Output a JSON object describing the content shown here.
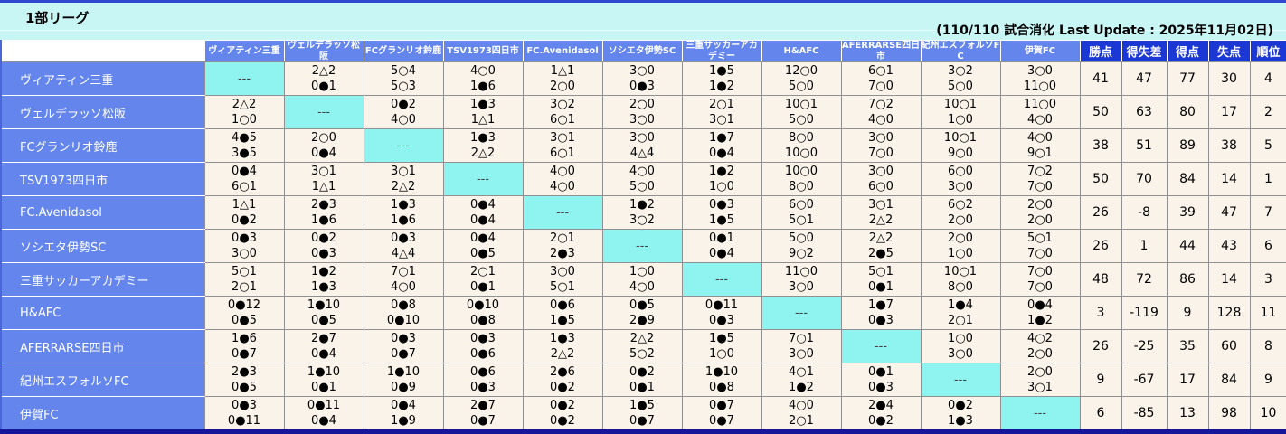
{
  "title": "1部リーグ",
  "update_note": "(110/110 試合消化 Last Update : 2025年11月02日)",
  "legend": {
    "win": "○",
    "loss": "●",
    "draw": "△",
    "self": "---"
  },
  "colors": {
    "band_cyan": "#c8f6f4",
    "header_blue": "#6486ec",
    "stat_header_blue": "#1c38d4",
    "diagonal_cyan": "#8ff4f0",
    "cell_bg": "#faf3ea",
    "bottom_bar_navy": "#16169b"
  },
  "stat_headers": [
    "勝点",
    "得失差",
    "得点",
    "失点",
    "順位"
  ],
  "teams": [
    "ヴィアティン三重",
    "ヴェルデラッソ松阪",
    "FCグランリオ鈴鹿",
    "TSV1973四日市",
    "FC.Avenidasol",
    "ソシエタ伊勢SC",
    "三重サッカーアカデミー",
    "H&AFC",
    "AFERRARSE四日市",
    "紀州エスフォルソFC",
    "伊賀FC"
  ],
  "rows": [
    {
      "team": "ヴィアティン三重",
      "matches": [
        null,
        [
          "2△2",
          "0●1"
        ],
        [
          "5○4",
          "5○3"
        ],
        [
          "4○0",
          "1●6"
        ],
        [
          "1△1",
          "2○0"
        ],
        [
          "3○0",
          "0●3"
        ],
        [
          "1●5",
          "1●2"
        ],
        [
          "12○0",
          "5○0"
        ],
        [
          "6○1",
          "7○0"
        ],
        [
          "3○2",
          "5○0"
        ],
        [
          "3○0",
          "11○0"
        ]
      ],
      "stats": [
        41,
        47,
        77,
        30,
        4
      ]
    },
    {
      "team": "ヴェルデラッソ松阪",
      "matches": [
        [
          "2△2",
          "1○0"
        ],
        null,
        [
          "0●2",
          "4○0"
        ],
        [
          "1●3",
          "1△1"
        ],
        [
          "3○2",
          "6○1"
        ],
        [
          "2○0",
          "3○0"
        ],
        [
          "2○1",
          "3○1"
        ],
        [
          "10○1",
          "5○0"
        ],
        [
          "7○2",
          "4○0"
        ],
        [
          "10○1",
          "1○0"
        ],
        [
          "11○0",
          "4○0"
        ]
      ],
      "stats": [
        50,
        63,
        80,
        17,
        2
      ]
    },
    {
      "team": "FCグランリオ鈴鹿",
      "matches": [
        [
          "4●5",
          "3●5"
        ],
        [
          "2○0",
          "0●4"
        ],
        null,
        [
          "1●3",
          "2△2"
        ],
        [
          "3○1",
          "6○1"
        ],
        [
          "3○0",
          "4△4"
        ],
        [
          "1●7",
          "0●4"
        ],
        [
          "8○0",
          "10○0"
        ],
        [
          "3○0",
          "7○0"
        ],
        [
          "10○1",
          "9○0"
        ],
        [
          "4○0",
          "9○1"
        ]
      ],
      "stats": [
        38,
        51,
        89,
        38,
        5
      ]
    },
    {
      "team": "TSV1973四日市",
      "matches": [
        [
          "0●4",
          "6○1"
        ],
        [
          "3○1",
          "1△1"
        ],
        [
          "3○1",
          "2△2"
        ],
        null,
        [
          "4○0",
          "4○0"
        ],
        [
          "4○0",
          "5○0"
        ],
        [
          "1●2",
          "1○0"
        ],
        [
          "10○0",
          "8○0"
        ],
        [
          "3○0",
          "6○0"
        ],
        [
          "6○0",
          "3○0"
        ],
        [
          "7○2",
          "7○0"
        ]
      ],
      "stats": [
        50,
        70,
        84,
        14,
        1
      ]
    },
    {
      "team": "FC.Avenidasol",
      "matches": [
        [
          "1△1",
          "0●2"
        ],
        [
          "2●3",
          "1●6"
        ],
        [
          "1●3",
          "1●6"
        ],
        [
          "0●4",
          "0●4"
        ],
        null,
        [
          "1●2",
          "3○2"
        ],
        [
          "0●3",
          "1●5"
        ],
        [
          "6○0",
          "5○1"
        ],
        [
          "3○1",
          "2△2"
        ],
        [
          "6○2",
          "2○0"
        ],
        [
          "2○0",
          "2○0"
        ]
      ],
      "stats": [
        26,
        -8,
        39,
        47,
        7
      ]
    },
    {
      "team": "ソシエタ伊勢SC",
      "matches": [
        [
          "0●3",
          "3○0"
        ],
        [
          "0●2",
          "0●3"
        ],
        [
          "0●3",
          "4△4"
        ],
        [
          "0●4",
          "0●5"
        ],
        [
          "2○1",
          "2●3"
        ],
        null,
        [
          "0●1",
          "0●4"
        ],
        [
          "5○0",
          "9○2"
        ],
        [
          "2△2",
          "2●5"
        ],
        [
          "2○0",
          "1○0"
        ],
        [
          "5○1",
          "7○0"
        ]
      ],
      "stats": [
        26,
        1,
        44,
        43,
        6
      ]
    },
    {
      "team": "三重サッカーアカデミー",
      "matches": [
        [
          "5○1",
          "2○1"
        ],
        [
          "1●2",
          "1●3"
        ],
        [
          "7○1",
          "4○0"
        ],
        [
          "2○1",
          "0●1"
        ],
        [
          "3○0",
          "5○1"
        ],
        [
          "1○0",
          "4○0"
        ],
        null,
        [
          "11○0",
          "3○0"
        ],
        [
          "5○1",
          "0●1"
        ],
        [
          "10○1",
          "8○0"
        ],
        [
          "7○0",
          "7○0"
        ]
      ],
      "stats": [
        48,
        72,
        86,
        14,
        3
      ]
    },
    {
      "team": "H&AFC",
      "matches": [
        [
          "0●12",
          "0●5"
        ],
        [
          "1●10",
          "0●5"
        ],
        [
          "0●8",
          "0●10"
        ],
        [
          "0●10",
          "0●8"
        ],
        [
          "0●6",
          "1●5"
        ],
        [
          "0●5",
          "2●9"
        ],
        [
          "0●11",
          "0●3"
        ],
        null,
        [
          "1●7",
          "0●3"
        ],
        [
          "1●4",
          "2○1"
        ],
        [
          "0●4",
          "1●2"
        ]
      ],
      "stats": [
        3,
        -119,
        9,
        128,
        11
      ]
    },
    {
      "team": "AFERRARSE四日市",
      "matches": [
        [
          "1●6",
          "0●7"
        ],
        [
          "2●7",
          "0●4"
        ],
        [
          "0●3",
          "0●7"
        ],
        [
          "0●3",
          "0●6"
        ],
        [
          "1●3",
          "2△2"
        ],
        [
          "2△2",
          "5○2"
        ],
        [
          "1●5",
          "1○0"
        ],
        [
          "7○1",
          "3○0"
        ],
        null,
        [
          "1○0",
          "3○0"
        ],
        [
          "4○2",
          "2○0"
        ]
      ],
      "stats": [
        26,
        -25,
        35,
        60,
        8
      ]
    },
    {
      "team": "紀州エスフォルソFC",
      "matches": [
        [
          "2●3",
          "0●5"
        ],
        [
          "1●10",
          "0●1"
        ],
        [
          "1●10",
          "0●9"
        ],
        [
          "0●6",
          "0●3"
        ],
        [
          "2●6",
          "0●2"
        ],
        [
          "0●2",
          "0●1"
        ],
        [
          "1●10",
          "0●8"
        ],
        [
          "4○1",
          "1●2"
        ],
        [
          "0●1",
          "0●3"
        ],
        null,
        [
          "2○0",
          "3○1"
        ]
      ],
      "stats": [
        9,
        -67,
        17,
        84,
        9
      ]
    },
    {
      "team": "伊賀FC",
      "matches": [
        [
          "0●3",
          "0●11"
        ],
        [
          "0●11",
          "0●4"
        ],
        [
          "0●4",
          "1●9"
        ],
        [
          "2●7",
          "0●7"
        ],
        [
          "0●2",
          "0●2"
        ],
        [
          "1●5",
          "0●7"
        ],
        [
          "0●7",
          "0●7"
        ],
        [
          "4○0",
          "2○1"
        ],
        [
          "2●4",
          "0●2"
        ],
        [
          "0●2",
          "1●3"
        ],
        null
      ],
      "stats": [
        6,
        -85,
        13,
        98,
        10
      ]
    }
  ]
}
